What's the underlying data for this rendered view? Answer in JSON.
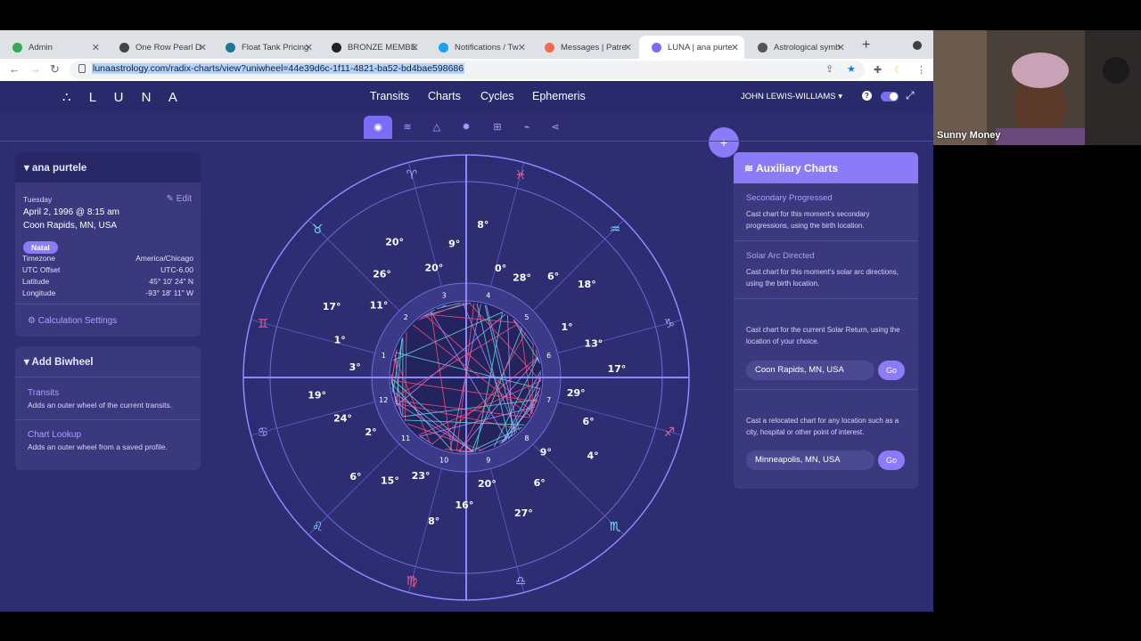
{
  "browser": {
    "tabs": [
      {
        "label": "Admin",
        "color": "#34a853"
      },
      {
        "label": "One Row Pearl D",
        "color": "#444"
      },
      {
        "label": "Float Tank Pricing",
        "color": "#21759b"
      },
      {
        "label": "BRONZE MEMBE",
        "color": "#222"
      },
      {
        "label": "Notifications / Tw",
        "color": "#1da1f2"
      },
      {
        "label": "Messages | Patre",
        "color": "#f96854"
      },
      {
        "label": "LUNA | ana purte",
        "color": "#7b6cf6"
      },
      {
        "label": "Astrological symb",
        "color": "#555"
      }
    ],
    "url": "lunaastrology.com/radix-charts/view?uniwheel=44e39d6c-1f11-4821-ba52-bd4bae598686"
  },
  "app": {
    "logo": "∴ L U N A",
    "menu": [
      "Transits",
      "Charts",
      "Cycles",
      "Ephemeris"
    ],
    "user": "JOHN LEWIS-WILLIAMS",
    "fab": "+"
  },
  "profile": {
    "name": "ana purtele",
    "day": "Tuesday",
    "edit": "Edit",
    "date": "April 2, 1996 @ 8:15 am",
    "location": "Coon Rapids, MN, USA",
    "type": "Natal",
    "rows": [
      {
        "k": "Timezone",
        "v": "America/Chicago"
      },
      {
        "k": "UTC Offset",
        "v": "UTC-6.00"
      },
      {
        "k": "Latitude",
        "v": "45° 10' 24\" N"
      },
      {
        "k": "Longitude",
        "v": "-93° 18' 11\" W"
      }
    ],
    "calc_settings": "Calculation Settings"
  },
  "biwheel": {
    "title": "Add Biwheel",
    "items": [
      {
        "title": "Transits",
        "desc": "Adds an outer wheel of the current transits."
      },
      {
        "title": "Chart Lookup",
        "desc": "Adds an outer wheel from a saved profile."
      }
    ]
  },
  "aux": {
    "title": "Auxiliary Charts",
    "secondary": {
      "title": "Secondary Progressed",
      "desc": "Cast chart for this moment's secondary progressions, using the birth location."
    },
    "solar_arc": {
      "title": "Solar Arc Directed",
      "desc": "Cast chart for this moment's solar arc directions, using the birth location."
    },
    "solar_return": {
      "desc": "Cast chart for the current Solar Return, using the location of your choice.",
      "input": "Coon Rapids, MN, USA",
      "go": "Go"
    },
    "relocated": {
      "desc": "Cast a relocated chart for any location such as a city, hospital or other point of interest.",
      "input": "Minneapolis, MN, USA",
      "go": "Go"
    }
  },
  "webcam": {
    "name": "Sunny Money"
  },
  "wheel": {
    "signs": [
      "♓",
      "♒",
      "♑",
      "♐",
      "♏",
      "♎",
      "♍",
      "♌",
      "♋",
      "♊",
      "♉",
      "♈"
    ],
    "houses": [
      "1",
      "2",
      "3",
      "4",
      "5",
      "6",
      "7",
      "8",
      "9",
      "10",
      "11",
      "12"
    ],
    "labels": [
      "28°",
      "6°",
      "18°",
      "1°",
      "13°",
      "17°",
      "29°",
      "6°",
      "4°",
      "9°",
      "6°",
      "27°",
      "20°",
      "16°",
      "8°",
      "23°",
      "15°",
      "6°",
      "2°",
      "24°",
      "19°",
      "3°",
      "1°",
      "17°",
      "11°",
      "26°",
      "20°",
      "20°",
      "9°",
      "8°",
      "0°"
    ]
  }
}
